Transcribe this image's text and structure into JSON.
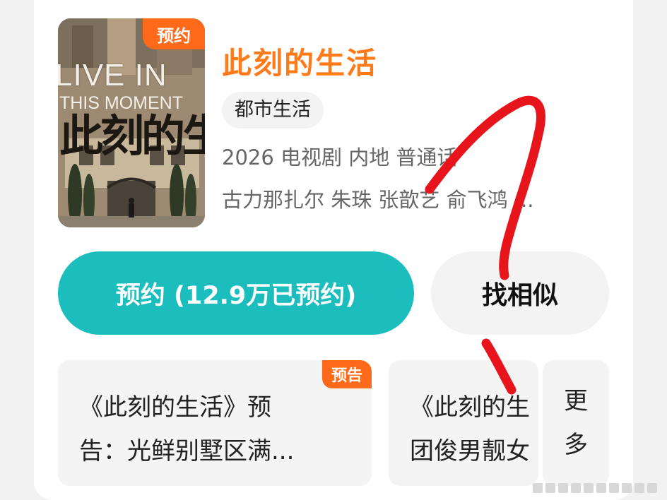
{
  "show": {
    "poster_badge": "预约",
    "poster_title_en_line1": "LIVE IN",
    "poster_title_en_line2": "THIS MOMENT",
    "poster_title_cn": "此刻的生活",
    "title": "此刻的生活",
    "genre": "都市生活",
    "meta": "2026 电视剧 内地 普通话",
    "cast": "古力那扎尔 朱珠 张歆艺 俞飞鸿 ..."
  },
  "actions": {
    "reserve_label": "预约 (12.9万已预约)",
    "similar_label": "找相似"
  },
  "clips": [
    {
      "badge": "预告",
      "line1": "《此刻的生活》预",
      "line2": "告：光鲜别墅区满..."
    },
    {
      "line1": "《此刻的生",
      "line2": "团俊男靓女"
    }
  ],
  "more": {
    "line1": "更",
    "line2": "多"
  },
  "colors": {
    "accent_orange": "#ff7a1a",
    "badge_orange": "#ff6a1a",
    "reserve_teal": "#1bbdbd",
    "scribble_red": "#e8141c"
  }
}
